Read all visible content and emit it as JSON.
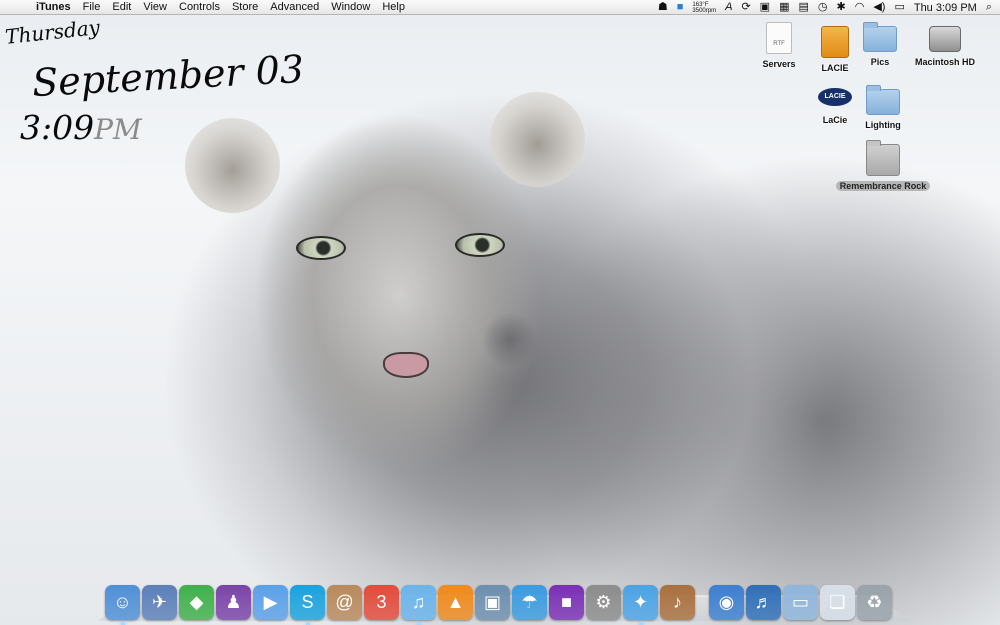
{
  "menubar": {
    "apple_icon": "apple-icon",
    "app_name": "iTunes",
    "menus": [
      "File",
      "Edit",
      "View",
      "Controls",
      "Store",
      "Advanced",
      "Window",
      "Help"
    ],
    "weather_temp": "163°F",
    "weather_rpm": "3500rpm",
    "clock": "Thu 3:09 PM"
  },
  "date_widget": {
    "day": "Thursday",
    "month_day": "September 03",
    "time": "3:09",
    "ampm": "PM"
  },
  "desktop_icons": {
    "servers": {
      "label": "Servers",
      "doc_tag": "RTF"
    },
    "lacie_drive": {
      "label": "LACIE"
    },
    "pics": {
      "label": "Pics"
    },
    "macintosh_hd": {
      "label": "Macintosh HD"
    },
    "lacie_app": {
      "label": "LaCie",
      "logo_text": "LACIE"
    },
    "lighting": {
      "label": "Lighting"
    },
    "remembrance_rock": {
      "label": "Remembrance Rock"
    }
  },
  "dock": {
    "items": [
      {
        "name": "finder",
        "icon": "finder-icon",
        "glyph": "☺",
        "color": "#4f8fd6",
        "running": true
      },
      {
        "name": "preview",
        "icon": "preview-icon",
        "glyph": "✈",
        "color": "#5b7fb8",
        "running": false
      },
      {
        "name": "sims",
        "icon": "sims-icon",
        "glyph": "◆",
        "color": "#3fb04a",
        "running": false
      },
      {
        "name": "adium",
        "icon": "adium-icon",
        "glyph": "♟",
        "color": "#7b43a8",
        "running": false
      },
      {
        "name": "ichat",
        "icon": "ichat-icon",
        "glyph": "▶",
        "color": "#5aa0e8",
        "running": false
      },
      {
        "name": "skype",
        "icon": "skype-icon",
        "glyph": "S",
        "color": "#19a2de",
        "running": true
      },
      {
        "name": "address-book",
        "icon": "address-book-icon",
        "glyph": "@",
        "color": "#b9895a",
        "running": false
      },
      {
        "name": "ical",
        "icon": "ical-icon",
        "glyph": "3",
        "color": "#e24b3b",
        "running": false
      },
      {
        "name": "itunes",
        "icon": "itunes-icon",
        "glyph": "♫",
        "color": "#6ab4ea",
        "running": true
      },
      {
        "name": "vlc",
        "icon": "vlc-cone-icon",
        "glyph": "▲",
        "color": "#f08a1c",
        "running": false
      },
      {
        "name": "iphoto",
        "icon": "iphoto-icon",
        "glyph": "▣",
        "color": "#6d8fb0",
        "running": false
      },
      {
        "name": "photos",
        "icon": "photo-album-icon",
        "glyph": "☂",
        "color": "#3a9be0",
        "running": false
      },
      {
        "name": "frontrow",
        "icon": "front-row-icon",
        "glyph": "■",
        "color": "#7a2fb5",
        "running": false
      },
      {
        "name": "system-preferences",
        "icon": "gear-icon",
        "glyph": "⚙",
        "color": "#8c8c8c",
        "running": false
      },
      {
        "name": "safari",
        "icon": "safari-compass-icon",
        "glyph": "✦",
        "color": "#4aa3e6",
        "running": true
      },
      {
        "name": "garageband",
        "icon": "guitar-icon",
        "glyph": "♪",
        "color": "#a9703e",
        "running": false
      },
      {
        "name": "gap",
        "icon": "",
        "glyph": "",
        "color": "",
        "running": false
      },
      {
        "name": "network",
        "icon": "network-icon",
        "glyph": "◉",
        "color": "#3d7fd1",
        "running": false
      },
      {
        "name": "guitar-app",
        "icon": "guitar-stack-icon",
        "glyph": "♬",
        "color": "#2f6fb8",
        "running": false
      },
      {
        "name": "applications-folder",
        "icon": "folder-icon",
        "glyph": "▭",
        "color": "#8fb6dc",
        "running": false
      },
      {
        "name": "documents",
        "icon": "document-icon",
        "glyph": "❏",
        "color": "#d8dfe8",
        "running": false
      },
      {
        "name": "trash",
        "icon": "trash-icon",
        "glyph": "♻",
        "color": "#9aa3ab",
        "running": false
      }
    ]
  }
}
